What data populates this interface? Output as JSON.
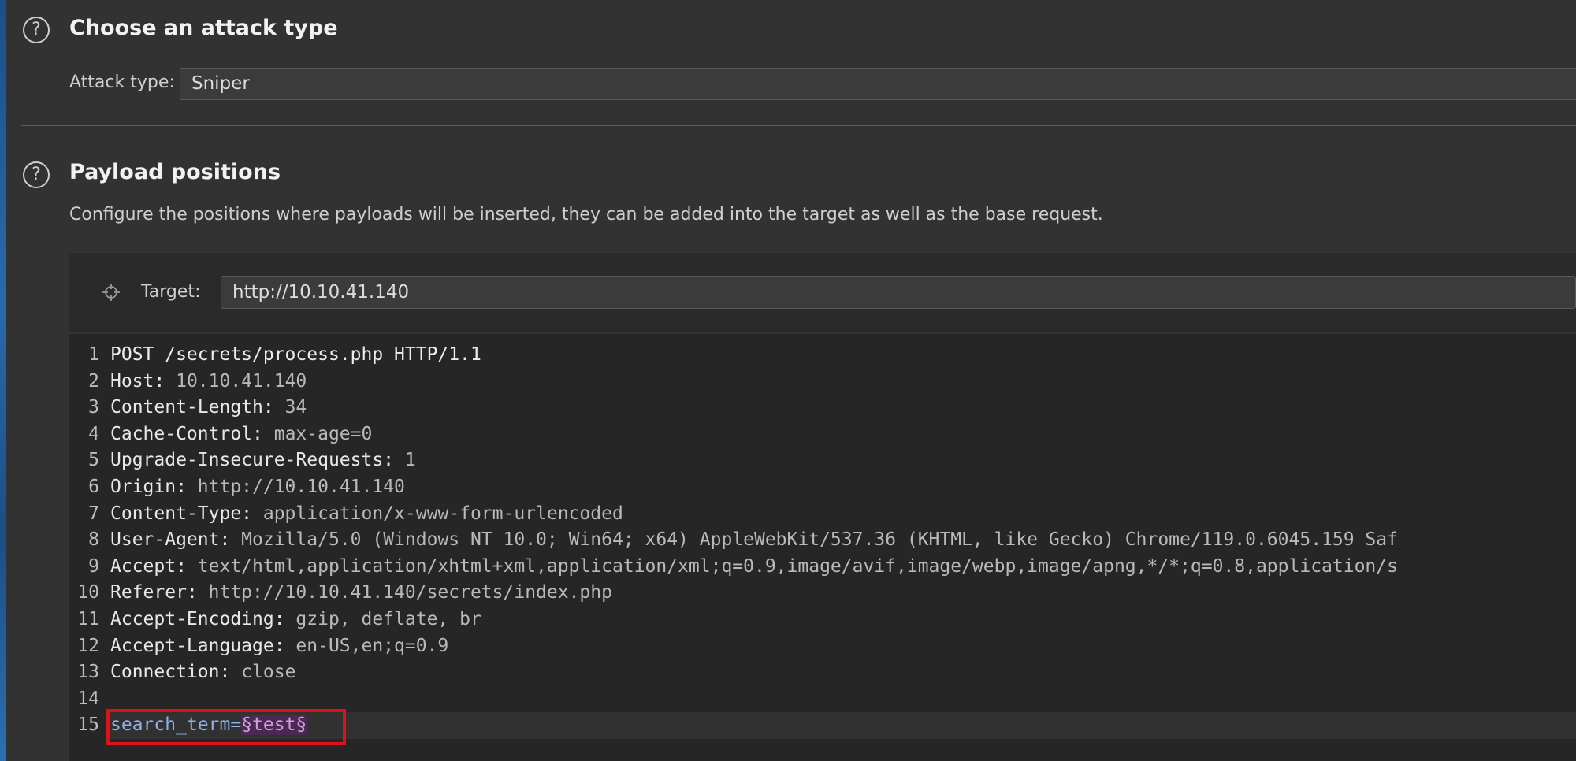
{
  "attack_section": {
    "title": "Choose an attack type",
    "label": "Attack type:",
    "selected": "Sniper"
  },
  "payload_section": {
    "title": "Payload positions",
    "description": "Configure the positions where payloads will be inserted, they can be added into the target as well as the base request.",
    "target_label": "Target:",
    "target_value": "http://10.10.41.140"
  },
  "icons": {
    "help": "?",
    "crosshair": "crosshair-icon"
  },
  "request": {
    "line_numbers": [
      "1",
      "2",
      "3",
      "4",
      "5",
      "6",
      "7",
      "8",
      "9",
      "10",
      "11",
      "12",
      "13",
      "14",
      "15"
    ],
    "request_line": "POST /secrets/process.php HTTP/1.1",
    "headers": [
      {
        "name": "Host:",
        "value": " 10.10.41.140"
      },
      {
        "name": "Content-Length:",
        "value": " 34"
      },
      {
        "name": "Cache-Control:",
        "value": " max-age=0"
      },
      {
        "name": "Upgrade-Insecure-Requests:",
        "value": " 1"
      },
      {
        "name": "Origin:",
        "value": " http://10.10.41.140"
      },
      {
        "name": "Content-Type:",
        "value": " application/x-www-form-urlencoded"
      },
      {
        "name": "User-Agent:",
        "value": " Mozilla/5.0 (Windows NT 10.0; Win64; x64) AppleWebKit/537.36 (KHTML, like Gecko) Chrome/119.0.6045.159 Saf"
      },
      {
        "name": "Accept:",
        "value": " text/html,application/xhtml+xml,application/xml;q=0.9,image/avif,image/webp,image/apng,*/*;q=0.8,application/s"
      },
      {
        "name": "Referer:",
        "value": " http://10.10.41.140/secrets/index.php"
      },
      {
        "name": "Accept-Encoding:",
        "value": " gzip, deflate, br"
      },
      {
        "name": "Accept-Language:",
        "value": " en-US,en;q=0.9"
      },
      {
        "name": "Connection:",
        "value": " close"
      }
    ],
    "body_param": "search_term",
    "body_eq": "=",
    "body_payload": "§test§"
  },
  "colors": {
    "highlight_border": "#e0101a",
    "payload_bg": "#4a2a52",
    "payload_fg": "#d49ce0",
    "param_fg": "#8fb0e8"
  }
}
